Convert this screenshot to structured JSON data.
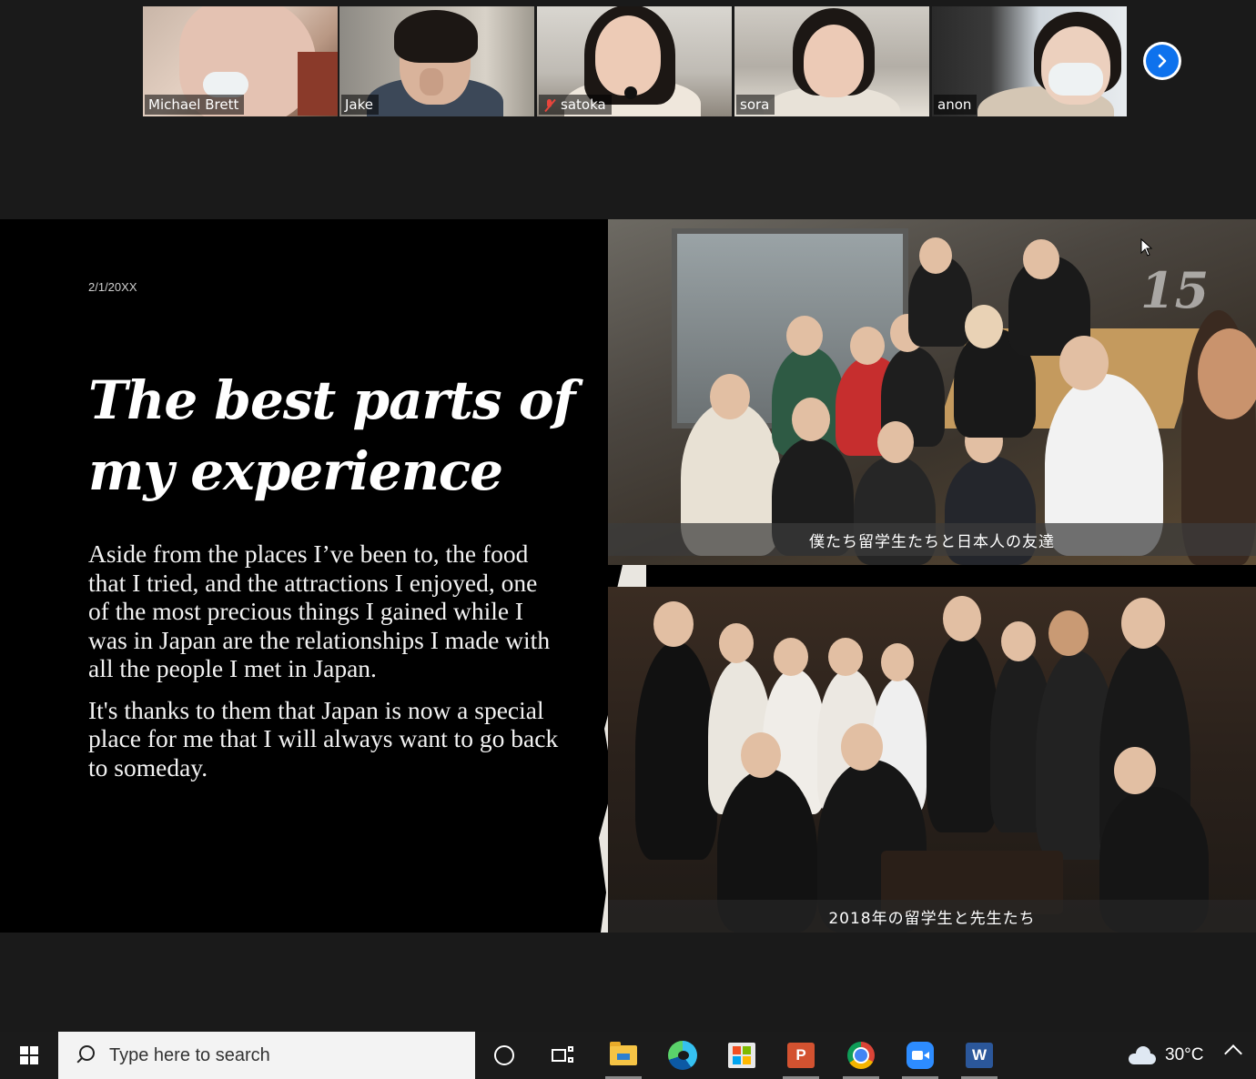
{
  "participants": [
    {
      "name": "Michael Brett",
      "muted": false,
      "active": false
    },
    {
      "name": "Jake",
      "muted": false,
      "active": true
    },
    {
      "name": "satoka",
      "muted": true,
      "active": false
    },
    {
      "name": "sora",
      "muted": false,
      "active": false
    },
    {
      "name": "anon",
      "muted": false,
      "active": false
    }
  ],
  "gallery": {
    "next_icon": "chevron-right-icon"
  },
  "slide": {
    "date": "2/1/20XX",
    "title": "The best parts of my experience",
    "paragraph1": "Aside from the places I’ve been to, the food that I tried, and the attractions I enjoyed, one of the most precious things I gained while I was in Japan are the relationships I made with all the people I met in Japan.",
    "paragraph2": "It's thanks to them that Japan is now a special place for me that I will always want to go back to someday.",
    "photo1_caption": "僕たち留学生たちと日本人の友達",
    "photo2_caption": "2018年の留学生と先生たち",
    "number": "15"
  },
  "taskbar": {
    "search_placeholder": "Type here to search",
    "temperature": "30°C",
    "apps": [
      "cortana",
      "task-view",
      "file-explorer",
      "edge",
      "store",
      "powerpoint",
      "chrome",
      "zoom",
      "word"
    ],
    "ppt_letter": "P",
    "word_letter": "W"
  },
  "colors": {
    "accent": "#0e72ed",
    "active_border": "#b8d06a",
    "powerpoint": "#d35230",
    "word": "#2b579a",
    "zoom": "#2d8cff"
  }
}
